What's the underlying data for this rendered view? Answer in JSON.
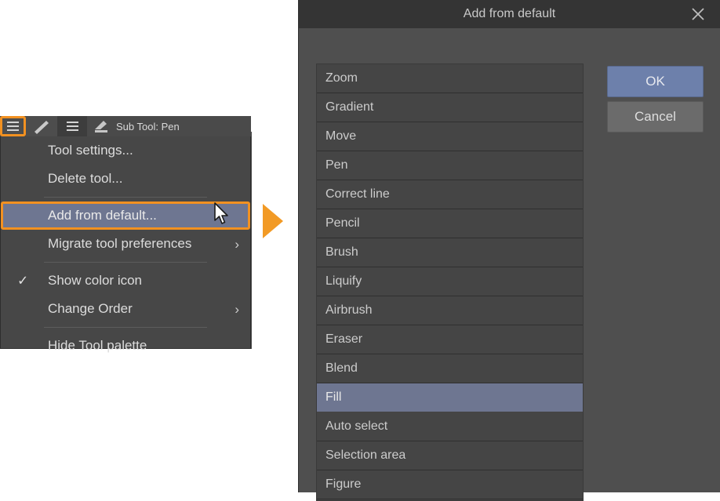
{
  "toolbar": {
    "hamburger_main_icon": "hamburger-menu-icon",
    "pen_swatch_icon": "pen-stroke-icon",
    "hamburger_secondary_icon": "hamburger-menu-icon",
    "subtool_icon": "pen-nib-icon",
    "subtool_label": "Sub Tool: Pen"
  },
  "context_menu": {
    "items": [
      {
        "label": "Tool settings...",
        "checked": false,
        "submenu": false,
        "selected": false
      },
      {
        "label": "Delete tool...",
        "checked": false,
        "submenu": false,
        "selected": false
      },
      {
        "label": "Add from default...",
        "checked": false,
        "submenu": false,
        "selected": true
      },
      {
        "label": "Migrate tool preferences",
        "checked": false,
        "submenu": true,
        "selected": false
      },
      {
        "label": "Show color icon",
        "checked": true,
        "submenu": false,
        "selected": false
      },
      {
        "label": "Change Order",
        "checked": false,
        "submenu": true,
        "selected": false
      },
      {
        "label": "Hide Tool palette",
        "checked": false,
        "submenu": false,
        "selected": false
      }
    ],
    "check_glyph": "✓",
    "submenu_glyph": "›"
  },
  "annotations": {
    "highlight_color": "#f29121",
    "flow_arrow_icon": "right-triangle-arrow-icon",
    "cursor_icon": "mouse-pointer-icon"
  },
  "dialog": {
    "title": "Add from default",
    "close_icon": "close-icon",
    "ok_label": "OK",
    "cancel_label": "Cancel",
    "selection_color": "#6e7691",
    "ok_color": "#6d80ab",
    "list": [
      {
        "label": "Zoom",
        "selected": false
      },
      {
        "label": "Gradient",
        "selected": false
      },
      {
        "label": "Move",
        "selected": false
      },
      {
        "label": "Pen",
        "selected": false
      },
      {
        "label": "Correct line",
        "selected": false
      },
      {
        "label": "Pencil",
        "selected": false
      },
      {
        "label": "Brush",
        "selected": false
      },
      {
        "label": "Liquify",
        "selected": false
      },
      {
        "label": "Airbrush",
        "selected": false
      },
      {
        "label": "Eraser",
        "selected": false
      },
      {
        "label": "Blend",
        "selected": false
      },
      {
        "label": "Fill",
        "selected": true
      },
      {
        "label": "Auto select",
        "selected": false
      },
      {
        "label": "Selection area",
        "selected": false
      },
      {
        "label": "Figure",
        "selected": false
      }
    ],
    "scrollbar": {
      "up_arrow_icon": "chevron-up-icon",
      "down_arrow_icon": "chevron-down-icon"
    }
  }
}
